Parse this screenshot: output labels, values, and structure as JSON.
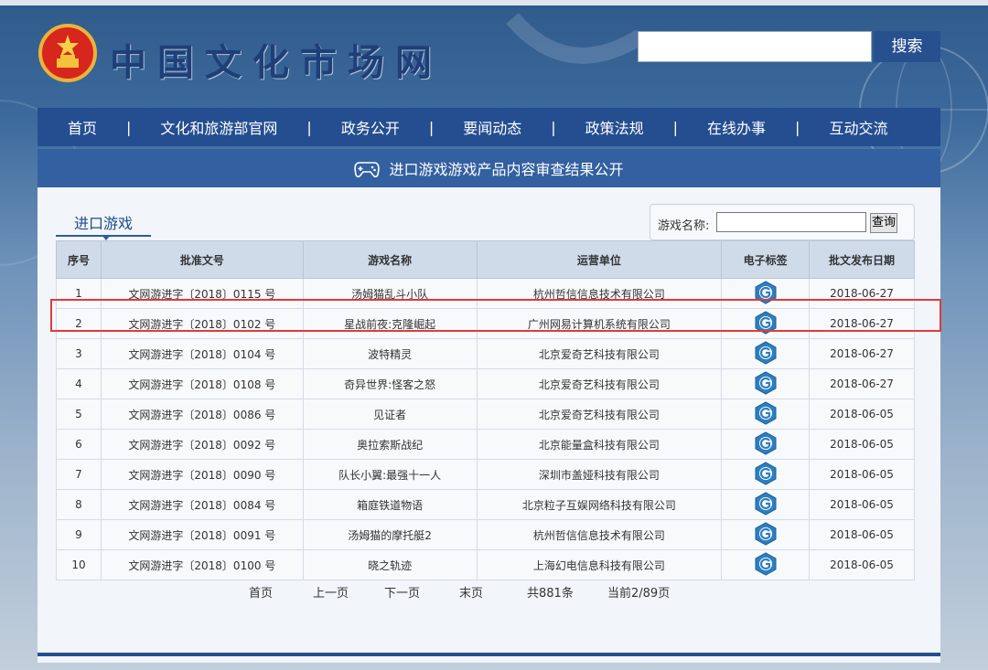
{
  "site": {
    "title": "中国文化市场网",
    "search_button": "搜索",
    "search_value": ""
  },
  "nav": [
    "首页",
    "文化和旅游部官网",
    "政务公开",
    "要闻动态",
    "政策法规",
    "在线办事",
    "互动交流"
  ],
  "nav_separator": "|",
  "page_title": "进口游戏游戏产品内容审查结果公开",
  "tab": "进口游戏",
  "filter": {
    "label": "游戏名称:",
    "value": "",
    "button": "查询"
  },
  "table": {
    "headers": [
      "序号",
      "批准文号",
      "游戏名称",
      "运营单位",
      "电子标签",
      "批文发布日期"
    ],
    "rows": [
      {
        "no": "1",
        "approval": "文网游进字〔2018〕0115 号",
        "name": "汤姆猫乱斗小队",
        "operator": "杭州哲信信息技术有限公司",
        "date": "2018-06-27"
      },
      {
        "no": "2",
        "approval": "文网游进字〔2018〕0102 号",
        "name": "星战前夜:克隆崛起",
        "operator": "广州网易计算机系统有限公司",
        "date": "2018-06-27"
      },
      {
        "no": "3",
        "approval": "文网游进字〔2018〕0104 号",
        "name": "波特精灵",
        "operator": "北京爱奇艺科技有限公司",
        "date": "2018-06-27"
      },
      {
        "no": "4",
        "approval": "文网游进字〔2018〕0108 号",
        "name": "奇异世界:怪客之怒",
        "operator": "北京爱奇艺科技有限公司",
        "date": "2018-06-27"
      },
      {
        "no": "5",
        "approval": "文网游进字〔2018〕0086 号",
        "name": "见证者",
        "operator": "北京爱奇艺科技有限公司",
        "date": "2018-06-05"
      },
      {
        "no": "6",
        "approval": "文网游进字〔2018〕0092 号",
        "name": "奥拉索斯战纪",
        "operator": "北京能量盒科技有限公司",
        "date": "2018-06-05"
      },
      {
        "no": "7",
        "approval": "文网游进字〔2018〕0090 号",
        "name": "队长小翼:最强十一人",
        "operator": "深圳市盖娅科技有限公司",
        "date": "2018-06-05"
      },
      {
        "no": "8",
        "approval": "文网游进字〔2018〕0084 号",
        "name": "箱庭铁道物语",
        "operator": "北京粒子互娱网络科技有限公司",
        "date": "2018-06-05"
      },
      {
        "no": "9",
        "approval": "文网游进字〔2018〕0091 号",
        "name": "汤姆猫的摩托艇2",
        "operator": "杭州哲信信息技术有限公司",
        "date": "2018-06-05"
      },
      {
        "no": "10",
        "approval": "文网游进字〔2018〕0100 号",
        "name": "晓之轨迹",
        "operator": "上海幻电信息科技有限公司",
        "date": "2018-06-05"
      }
    ]
  },
  "pager": {
    "first": "首页",
    "prev": "上一页",
    "next": "下一页",
    "last": "末页",
    "total": "共881条",
    "current": "当前2/89页"
  },
  "colors": {
    "nav_bg": "#244e90",
    "title_bg": "#3360a0",
    "highlight": "#e03a3a",
    "header_bg": "#d0dbea"
  }
}
